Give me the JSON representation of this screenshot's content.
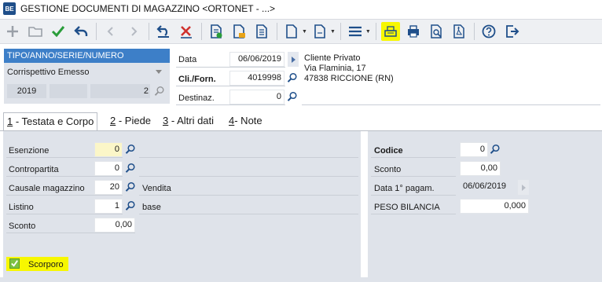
{
  "window": {
    "logo": "BE",
    "title": "GESTIONE DOCUMENTI DI MAGAZZINO <ORTONET - ...>"
  },
  "toolbar": {
    "icons": [
      "plus-icon",
      "folder-icon",
      "check-icon",
      "undo-icon",
      "prev-icon",
      "next-icon",
      "revert-icon",
      "delete-icon",
      "document-money-icon",
      "document-folder-icon",
      "document-list-icon",
      "new-document-dropdown-icon",
      "document-dropdown-icon",
      "menu-icon",
      "cash-register-icon",
      "print-icon",
      "print-preview-icon",
      "pdf-icon",
      "help-icon",
      "exit-icon"
    ]
  },
  "header": {
    "panel_title": "TIPO/ANNO/SERIE/NUMERO",
    "doc_type": "Corrispettivo Emesso",
    "year": "2019",
    "number": "2",
    "date_label": "Data",
    "date_value": "06/06/2019",
    "customer_label": "Cli./Forn.",
    "customer_code": "4019998",
    "destination_label": "Destinaz.",
    "destination_value": "0",
    "customer_name": "Cliente Privato",
    "customer_street": "Via Flaminia, 17",
    "customer_city": "47838 RICCIONE (RN)"
  },
  "tabs": [
    {
      "num": "1",
      "label": " - Testata e Corpo"
    },
    {
      "num": "2",
      "label": " - Piede"
    },
    {
      "num": "3",
      "label": " - Altri dati"
    },
    {
      "num": "4",
      "label": "- Note"
    }
  ],
  "left_form": {
    "esenzione_label": "Esenzione",
    "esenzione_value": "0",
    "contropartita_label": "Contropartita",
    "contropartita_value": "0",
    "causale_label": "Causale magazzino",
    "causale_value": "20",
    "causale_desc": "Vendita",
    "listino_label": "Listino",
    "listino_value": "1",
    "listino_desc": "base",
    "sconto_label": "Sconto",
    "sconto_value": "0,00",
    "scorporo_label": "Scorporo"
  },
  "right_form": {
    "codice_label": "Codice",
    "codice_value": "0",
    "sconto_label": "Sconto",
    "sconto_value": "0,00",
    "data_pagam_label": "Data 1° pagam.",
    "data_pagam_value": "06/06/2019",
    "peso_label": "PESO BILANCIA",
    "peso_value": "0,000"
  },
  "colors": {
    "accent": "#3d7fc8",
    "highlight": "#f7f700",
    "panel": "#dfe3ea",
    "check_green": "#7dc242"
  }
}
